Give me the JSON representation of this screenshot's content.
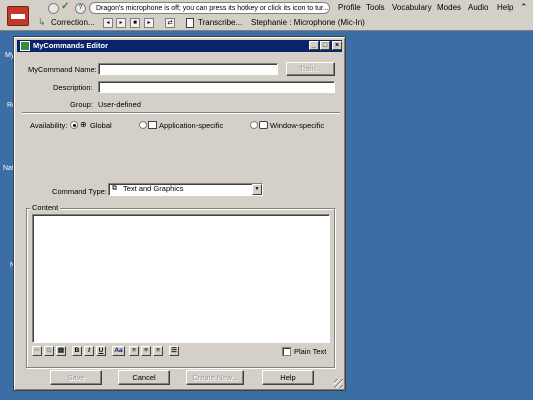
{
  "dragon_bar": {
    "status_message": "Dragon's microphone is off; you can press its hotkey or click its icon to tur...",
    "correction_label": "Correction...",
    "transcribe_label": "Transcribe...",
    "profile_status": "Stephanie : Microphone (Mic-In)",
    "menu": {
      "profile": "Profile",
      "tools": "Tools",
      "vocabulary": "Vocabulary",
      "modes": "Modes",
      "audio": "Audio",
      "help": "Help",
      "collapse": "⌃"
    }
  },
  "desktop": {
    "fragments": [
      "My",
      "Re",
      "Nat",
      "N"
    ]
  },
  "dialog": {
    "title": "MyCommands Editor",
    "fields": {
      "name_label": "MyCommand Name:",
      "name_value": "",
      "train_label": "Train...",
      "description_label": "Description:",
      "description_value": "",
      "group_label": "Group:",
      "group_value": "User-defined"
    },
    "availability": {
      "label": "Availability:",
      "options": [
        {
          "label": "Global",
          "checked": true
        },
        {
          "label": "Application-specific",
          "checked": false
        },
        {
          "label": "Window-specific",
          "checked": false
        }
      ]
    },
    "command_type": {
      "label": "Command Type:",
      "value": "Text and Graphics"
    },
    "content": {
      "legend": "Content",
      "text": "",
      "plain_text_label": "Plain Text",
      "plain_text_checked": false,
      "format_labels": {
        "bold": "B",
        "italic": "I",
        "underline": "U",
        "font": "Aa"
      }
    },
    "buttons": {
      "save": "Save",
      "cancel": "Cancel",
      "create_new": "Create New...",
      "help": "Help"
    }
  }
}
